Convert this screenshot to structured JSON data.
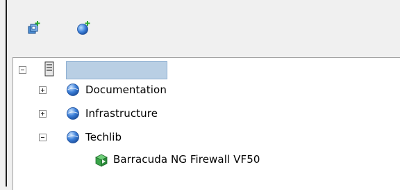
{
  "toolbar": {
    "buttons": [
      {
        "icon": "add-server-icon"
      },
      {
        "icon": "add-group-icon"
      }
    ]
  },
  "tree": {
    "root": {
      "icon": "server-icon",
      "name": "",
      "expanded": true
    },
    "groups": [
      {
        "label": "Documentation",
        "icon": "globe-icon",
        "expanded": false
      },
      {
        "label": "Infrastructure",
        "icon": "globe-icon",
        "expanded": false
      },
      {
        "label": "Techlib",
        "icon": "globe-icon",
        "expanded": true,
        "children": [
          {
            "label": "Barracuda NG Firewall VF50",
            "icon": "firewall-box-icon"
          }
        ]
      }
    ]
  },
  "colors": {
    "selection": "#b9cfe4",
    "globe": "#3b7fd9",
    "plus": "#2eaa2e",
    "firewall": "#3aa54a"
  }
}
